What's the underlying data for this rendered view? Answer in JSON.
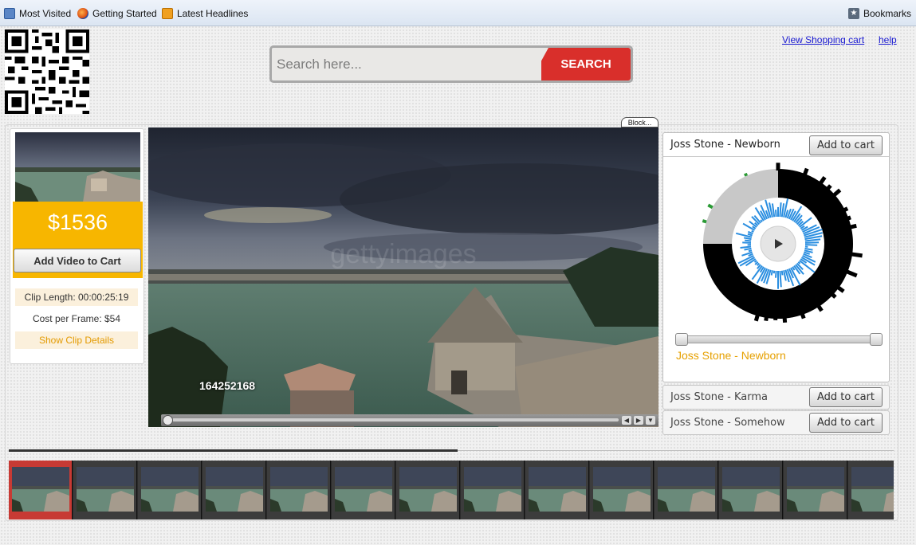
{
  "bookmarks_bar": {
    "items": [
      {
        "label": "Most Visited",
        "icon": "bookmark-folder-icon"
      },
      {
        "label": "Getting Started",
        "icon": "firefox-icon"
      },
      {
        "label": "Latest Headlines",
        "icon": "rss-feed-icon"
      }
    ],
    "bookmarks_label": "Bookmarks"
  },
  "header": {
    "search_placeholder": "Search here...",
    "search_button": "SEARCH",
    "view_cart_link": "View Shopping cart",
    "help_link": "help"
  },
  "block_tab": "Block...",
  "clip": {
    "price": "$1536",
    "add_button": "Add Video to Cart",
    "clip_length": "Clip Length: 00:00:25:19",
    "cost_per_frame": "Cost per Frame: $54",
    "show_details": "Show Clip Details",
    "clip_id": "164252168"
  },
  "player": {
    "watermark": "gettyimages"
  },
  "music": {
    "tracks": [
      {
        "title": "Joss Stone - Newborn",
        "button": "Add to cart"
      },
      {
        "title": "Joss Stone - Karma",
        "button": "Add to cart"
      },
      {
        "title": "Joss Stone - Somehow",
        "button": "Add to cart"
      }
    ],
    "now_playing": "Joss Stone - Newborn"
  },
  "filmstrip": {
    "frame_count": 14,
    "active_index": 0
  },
  "colors": {
    "accent_red": "#d92f2b",
    "price_yellow": "#f7b600",
    "link_blue": "#1a1ad1",
    "orange_text": "#e6a000",
    "visualizer_blue": "#2a8ee0",
    "visualizer_green": "#2a9a35"
  }
}
